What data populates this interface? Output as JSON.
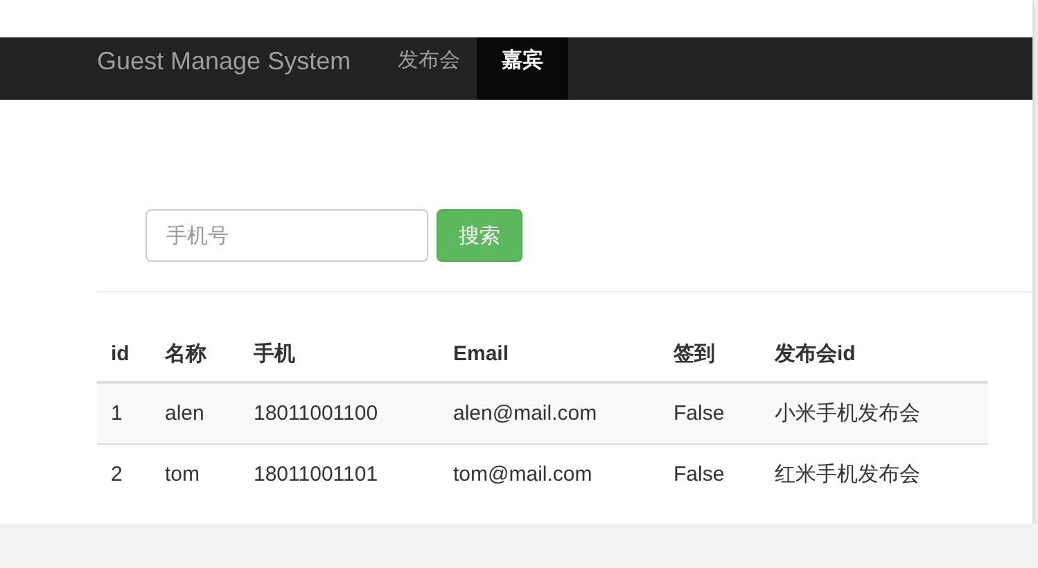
{
  "navbar": {
    "brand": "Guest Manage System",
    "items": [
      {
        "label": "发布会",
        "selected": false
      },
      {
        "label": "嘉宾",
        "selected": true
      }
    ]
  },
  "search": {
    "placeholder": "手机号",
    "button": "搜索"
  },
  "table": {
    "columns": [
      "id",
      "名称",
      "手机",
      "Email",
      "签到",
      "发布会id"
    ],
    "rows": [
      [
        "1",
        "alen",
        "18011001100",
        "alen@mail.com",
        "False",
        "小米手机发布会"
      ],
      [
        "2",
        "tom",
        "18011001101",
        "tom@mail.com",
        "False",
        "红米手机发布会"
      ]
    ]
  }
}
